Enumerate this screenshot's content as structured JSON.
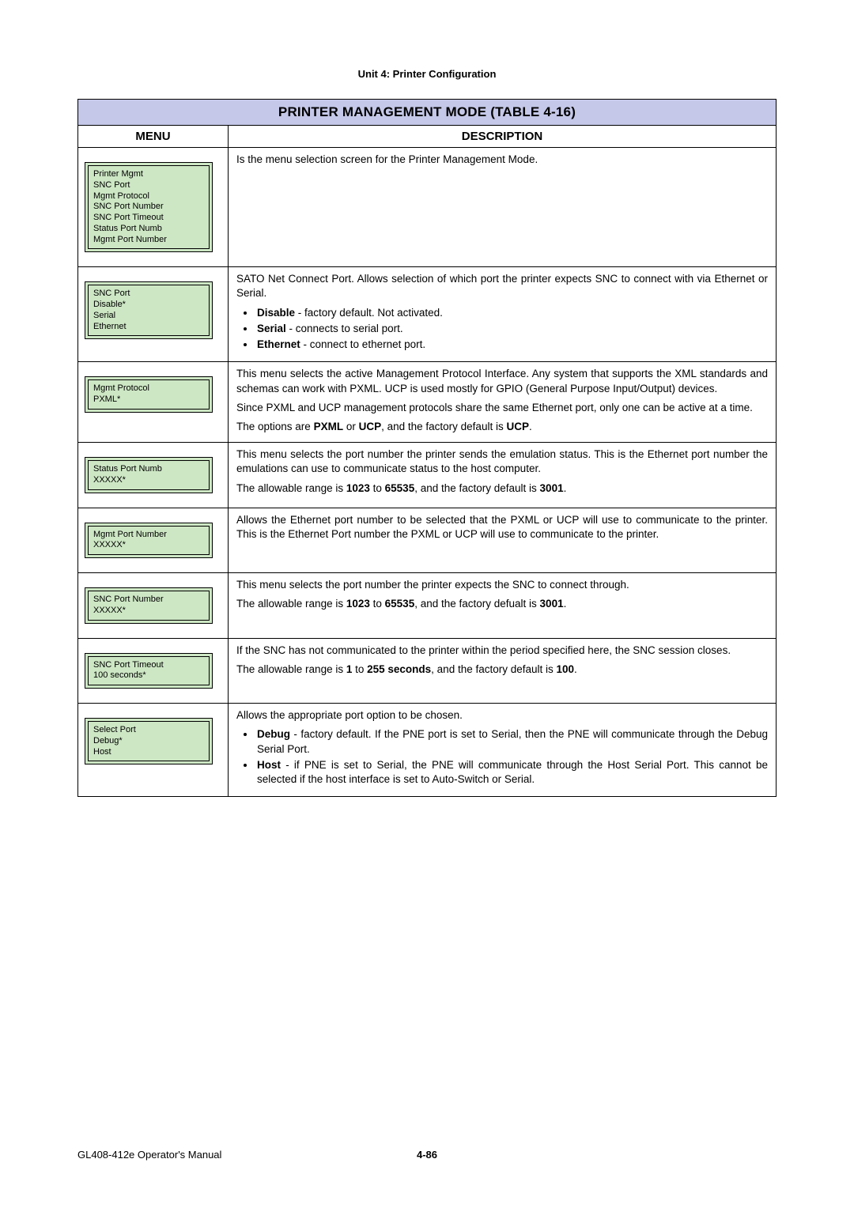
{
  "unit_header": "Unit 4:  Printer Configuration",
  "table_title": "PRINTER MANAGEMENT MODE (TABLE 4-16)",
  "col_menu": "MENU",
  "col_desc": "DESCRIPTION",
  "rows": [
    {
      "lcd": [
        "Printer Mgmt",
        "SNC Port",
        "Mgmt Protocol",
        "SNC Port Number",
        "SNC Port Timeout",
        "Status Port Numb",
        "Mgmt Port Number"
      ],
      "desc_plain": "Is the menu selection screen for the Printer Management Mode."
    },
    {
      "lcd": [
        "SNC Port",
        "Disable*",
        "Serial",
        "Ethernet"
      ],
      "desc_intro": "SATO Net Connect Port. Allows selection of which port the printer expects SNC to connect with via Ethernet or Serial.",
      "bullets": [
        {
          "bold": "Disable",
          "rest": " - factory default. Not activated."
        },
        {
          "bold": "Serial",
          "rest": " - connects to serial port."
        },
        {
          "bold": "Ethernet",
          "rest": " - connect to ethernet port."
        }
      ]
    },
    {
      "lcd": [
        "Mgmt Protocol",
        "PXML*"
      ],
      "desc_paras": [
        "This menu selects the active Management Protocol Interface. Any system that supports the XML standards and schemas can work with PXML. UCP is used mostly for GPIO (General Purpose Input/Output) devices.",
        "Since PXML and UCP management protocols share the same Ethernet port, only one can be active at a time."
      ],
      "desc_final_html": "The options are <b>PXML</b> or <b>UCP</b>, and the factory default is <b>UCP</b>."
    },
    {
      "lcd": [
        "Status Port Numb",
        "XXXXX*"
      ],
      "desc_paras": [
        "This menu selects the port number the printer sends the emulation status. This is the Ethernet port number the emulations can use to communicate status to the host computer."
      ],
      "desc_final_html": "The allowable range is <b>1023</b> to <b>65535</b>, and the factory default is <b>3001</b>."
    },
    {
      "lcd": [
        "Mgmt Port Number",
        "XXXXX*"
      ],
      "desc_plain": "Allows the Ethernet port number to be selected that the PXML or UCP will use to communicate to the printer. This is the Ethernet Port number the PXML or UCP will use to communicate to the printer."
    },
    {
      "lcd": [
        "SNC Port Number",
        "XXXXX*"
      ],
      "desc_paras": [
        "This menu selects the port number the printer expects the SNC to connect through."
      ],
      "desc_final_html": "The allowable range is <b>1023</b> to <b>65535</b>, and the factory defualt is <b>3001</b>."
    },
    {
      "lcd": [
        "SNC Port Timeout",
        "100  seconds*"
      ],
      "desc_paras": [
        "If the SNC has not communicated to the printer within the period specified here, the SNC session closes."
      ],
      "desc_final_html": "The allowable range is <b>1</b> to <b>255 seconds</b>, and the factory default is <b>100</b>."
    },
    {
      "lcd": [
        "Select Port",
        "Debug*",
        "Host"
      ],
      "desc_intro": "Allows the appropriate port option to be chosen.",
      "bullets": [
        {
          "bold": "Debug",
          "rest": " - factory default. If the PNE port is set to Serial, then the PNE will communicate through the Debug Serial Port."
        },
        {
          "bold": "Host",
          "rest": " - if PNE is set to Serial, the PNE will communicate through the Host Serial Port. This cannot be selected if the host interface is set to Auto-Switch or Serial."
        }
      ]
    }
  ],
  "footer_left": "GL408-412e Operator's Manual",
  "footer_page": "4-86",
  "chart_data": {
    "type": "table",
    "title": "PRINTER MANAGEMENT MODE (TABLE 4-16)",
    "columns": [
      "MENU",
      "DESCRIPTION"
    ],
    "rows": [
      [
        "Printer Mgmt / SNC Port / Mgmt Protocol / SNC Port Number / SNC Port Timeout / Status Port Numb / Mgmt Port Number",
        "Menu selection screen for Printer Management Mode."
      ],
      [
        "SNC Port: Disable* / Serial / Ethernet",
        "SATO Net Connect Port. Disable=factory default, Serial=connects to serial port, Ethernet=connect to ethernet port."
      ],
      [
        "Mgmt Protocol: PXML*",
        "Selects active management protocol interface (PXML or UCP). Factory default UCP."
      ],
      [
        "Status Port Numb: XXXXX*",
        "Port number for emulation status. Range 1023-65535, default 3001."
      ],
      [
        "Mgmt Port Number: XXXXX*",
        "Ethernet port number PXML/UCP uses to communicate to printer."
      ],
      [
        "SNC Port Number: XXXXX*",
        "Port number printer expects SNC to connect through. Range 1023-65535, default 3001."
      ],
      [
        "SNC Port Timeout: 100 seconds*",
        "SNC session closes if no communication within period. Range 1-255 seconds, default 100."
      ],
      [
        "Select Port: Debug* / Host",
        "Debug=factory default via Debug Serial Port; Host=PNE communicates through Host Serial Port."
      ]
    ]
  }
}
